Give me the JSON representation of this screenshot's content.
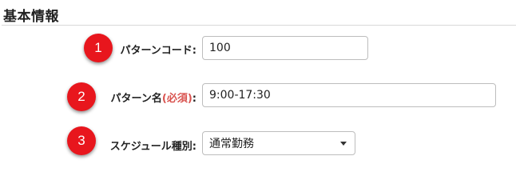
{
  "section": {
    "title": "基本情報"
  },
  "rows": [
    {
      "number": "1",
      "label": "パターンコード",
      "required_text": "",
      "colon": ":",
      "value": "100"
    },
    {
      "number": "2",
      "label": "パターン名",
      "required_text": "(必須)",
      "colon": ":",
      "value": "9:00-17:30"
    },
    {
      "number": "3",
      "label": "スケジュール種別",
      "required_text": "",
      "colon": ":",
      "value": "通常勤務"
    }
  ],
  "colors": {
    "badge": "#e8161d",
    "required": "#d9534f"
  }
}
